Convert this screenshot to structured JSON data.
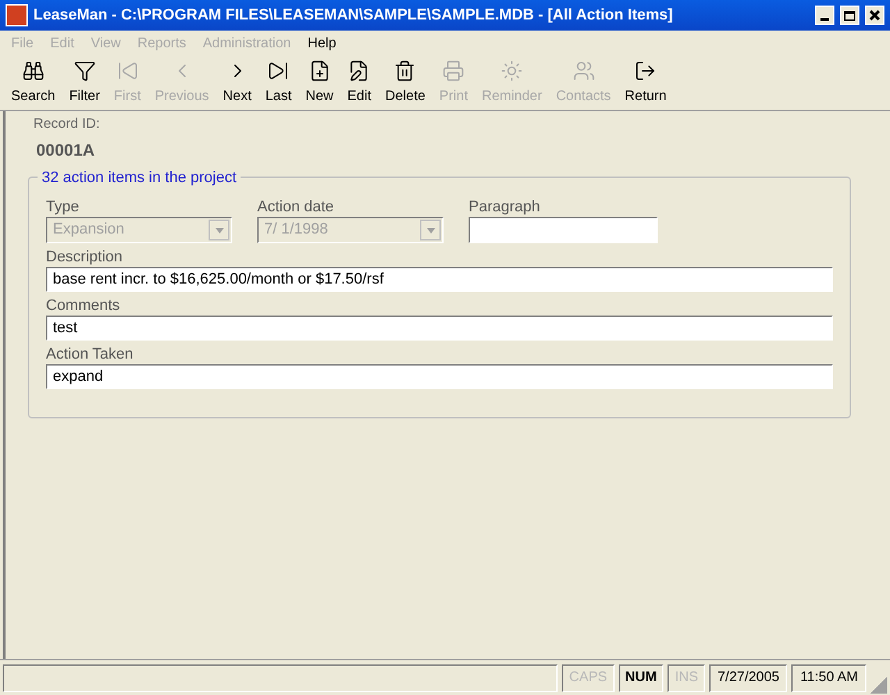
{
  "window": {
    "title": "LeaseMan - C:\\PROGRAM FILES\\LEASEMAN\\SAMPLE\\SAMPLE.MDB - [All Action Items]"
  },
  "menu": [
    {
      "label": "File",
      "disabled": true
    },
    {
      "label": "Edit",
      "disabled": true
    },
    {
      "label": "View",
      "disabled": true
    },
    {
      "label": "Reports",
      "disabled": true
    },
    {
      "label": "Administration",
      "disabled": true
    },
    {
      "label": "Help",
      "disabled": false
    }
  ],
  "toolbar": [
    {
      "kind": "search",
      "label": "Search",
      "disabled": false
    },
    {
      "kind": "filter",
      "label": "Filter",
      "disabled": false
    },
    {
      "kind": "first",
      "label": "First",
      "disabled": true
    },
    {
      "kind": "previous",
      "label": "Previous",
      "disabled": true
    },
    {
      "kind": "next",
      "label": "Next",
      "disabled": false
    },
    {
      "kind": "last",
      "label": "Last",
      "disabled": false
    },
    {
      "kind": "new",
      "label": "New",
      "disabled": false
    },
    {
      "kind": "edit",
      "label": "Edit",
      "disabled": false
    },
    {
      "kind": "delete",
      "label": "Delete",
      "disabled": false
    },
    {
      "kind": "print",
      "label": "Print",
      "disabled": true
    },
    {
      "kind": "reminder",
      "label": "Reminder",
      "disabled": true
    },
    {
      "kind": "contacts",
      "label": "Contacts",
      "disabled": true
    },
    {
      "kind": "return",
      "label": "Return",
      "disabled": false
    }
  ],
  "record": {
    "label": "Record ID:",
    "value": "00001A"
  },
  "group": {
    "title": "32 action items in the project",
    "type": {
      "label": "Type",
      "value": "Expansion",
      "disabled": true
    },
    "action_date": {
      "label": "Action date",
      "value": "7/ 1/1998",
      "disabled": true
    },
    "paragraph": {
      "label": "Paragraph"
    },
    "description": {
      "label": "Description",
      "value": "base rent incr. to $16,625.00/month or $17.50/rsf"
    },
    "comments": {
      "label": "Comments",
      "value": "test"
    },
    "action_taken": {
      "label": "Action Taken",
      "value": "expand"
    }
  },
  "status_bar": {
    "indicators": [
      {
        "label": "CAPS",
        "on": false
      },
      {
        "label": "NUM",
        "on": true
      },
      {
        "label": "INS",
        "on": false
      }
    ],
    "date": "7/27/2005",
    "time": "11:50 AM"
  }
}
